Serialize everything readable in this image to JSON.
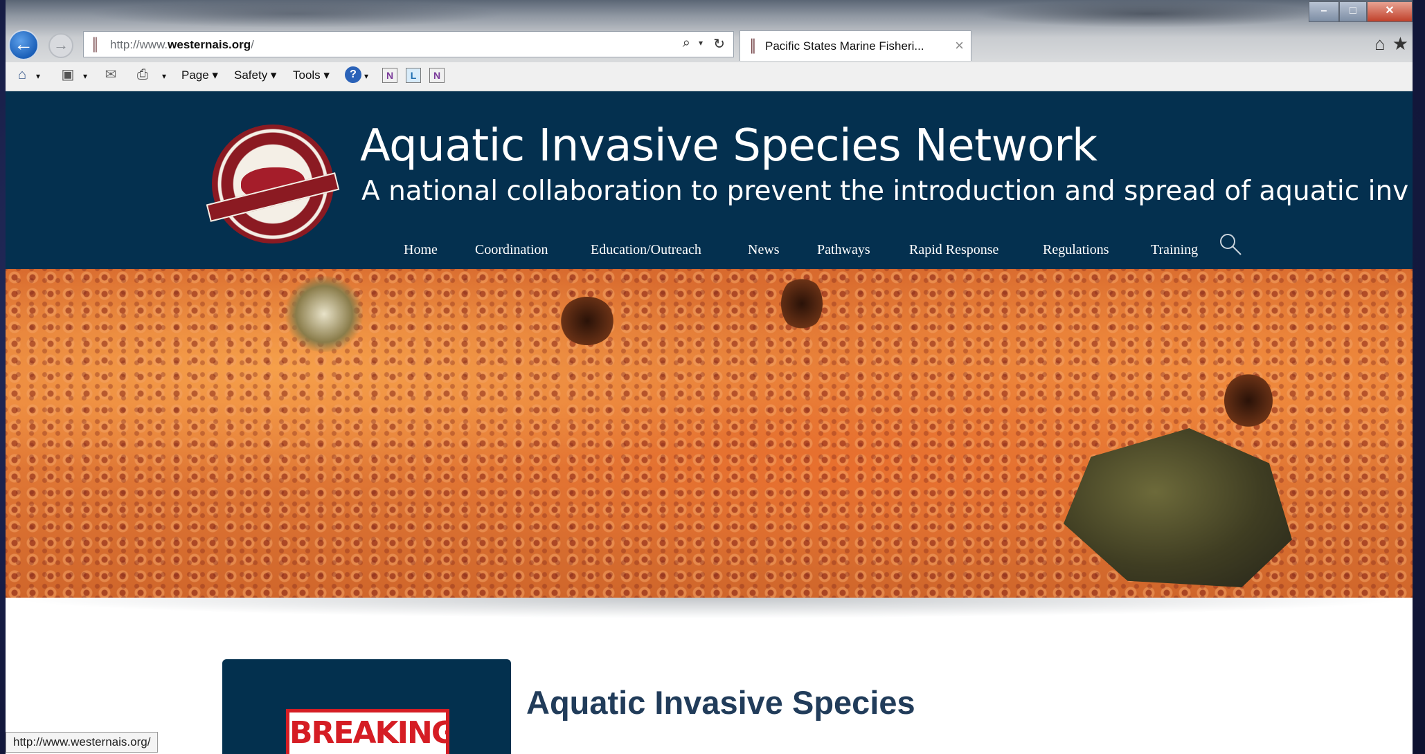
{
  "browser": {
    "address_url_prefix": "http://www.",
    "address_url_domain": "westernais.org",
    "address_url_suffix": "/",
    "tab_title": "Pacific States Marine Fisheri...",
    "status_url": "http://www.westernais.org/"
  },
  "commandbar": {
    "page_label": "Page ▾",
    "safety_label": "Safety ▾",
    "tools_label": "Tools ▾"
  },
  "site": {
    "title": "Aquatic Invasive Species Network",
    "subtitle": "A national collaboration to prevent the introduction and spread of aquatic inv",
    "nav": [
      "Home",
      "Coordination",
      "Education/Outreach",
      "News",
      "Pathways",
      "Rapid Response",
      "Regulations",
      "Training"
    ]
  },
  "content": {
    "breaking_label": "BREAKING",
    "heading": "Aquatic Invasive Species"
  },
  "colors": {
    "header_bg": "#04304f",
    "card_bg": "#03304e",
    "heading": "#213c5a",
    "breaking_red": "#d51d24"
  }
}
